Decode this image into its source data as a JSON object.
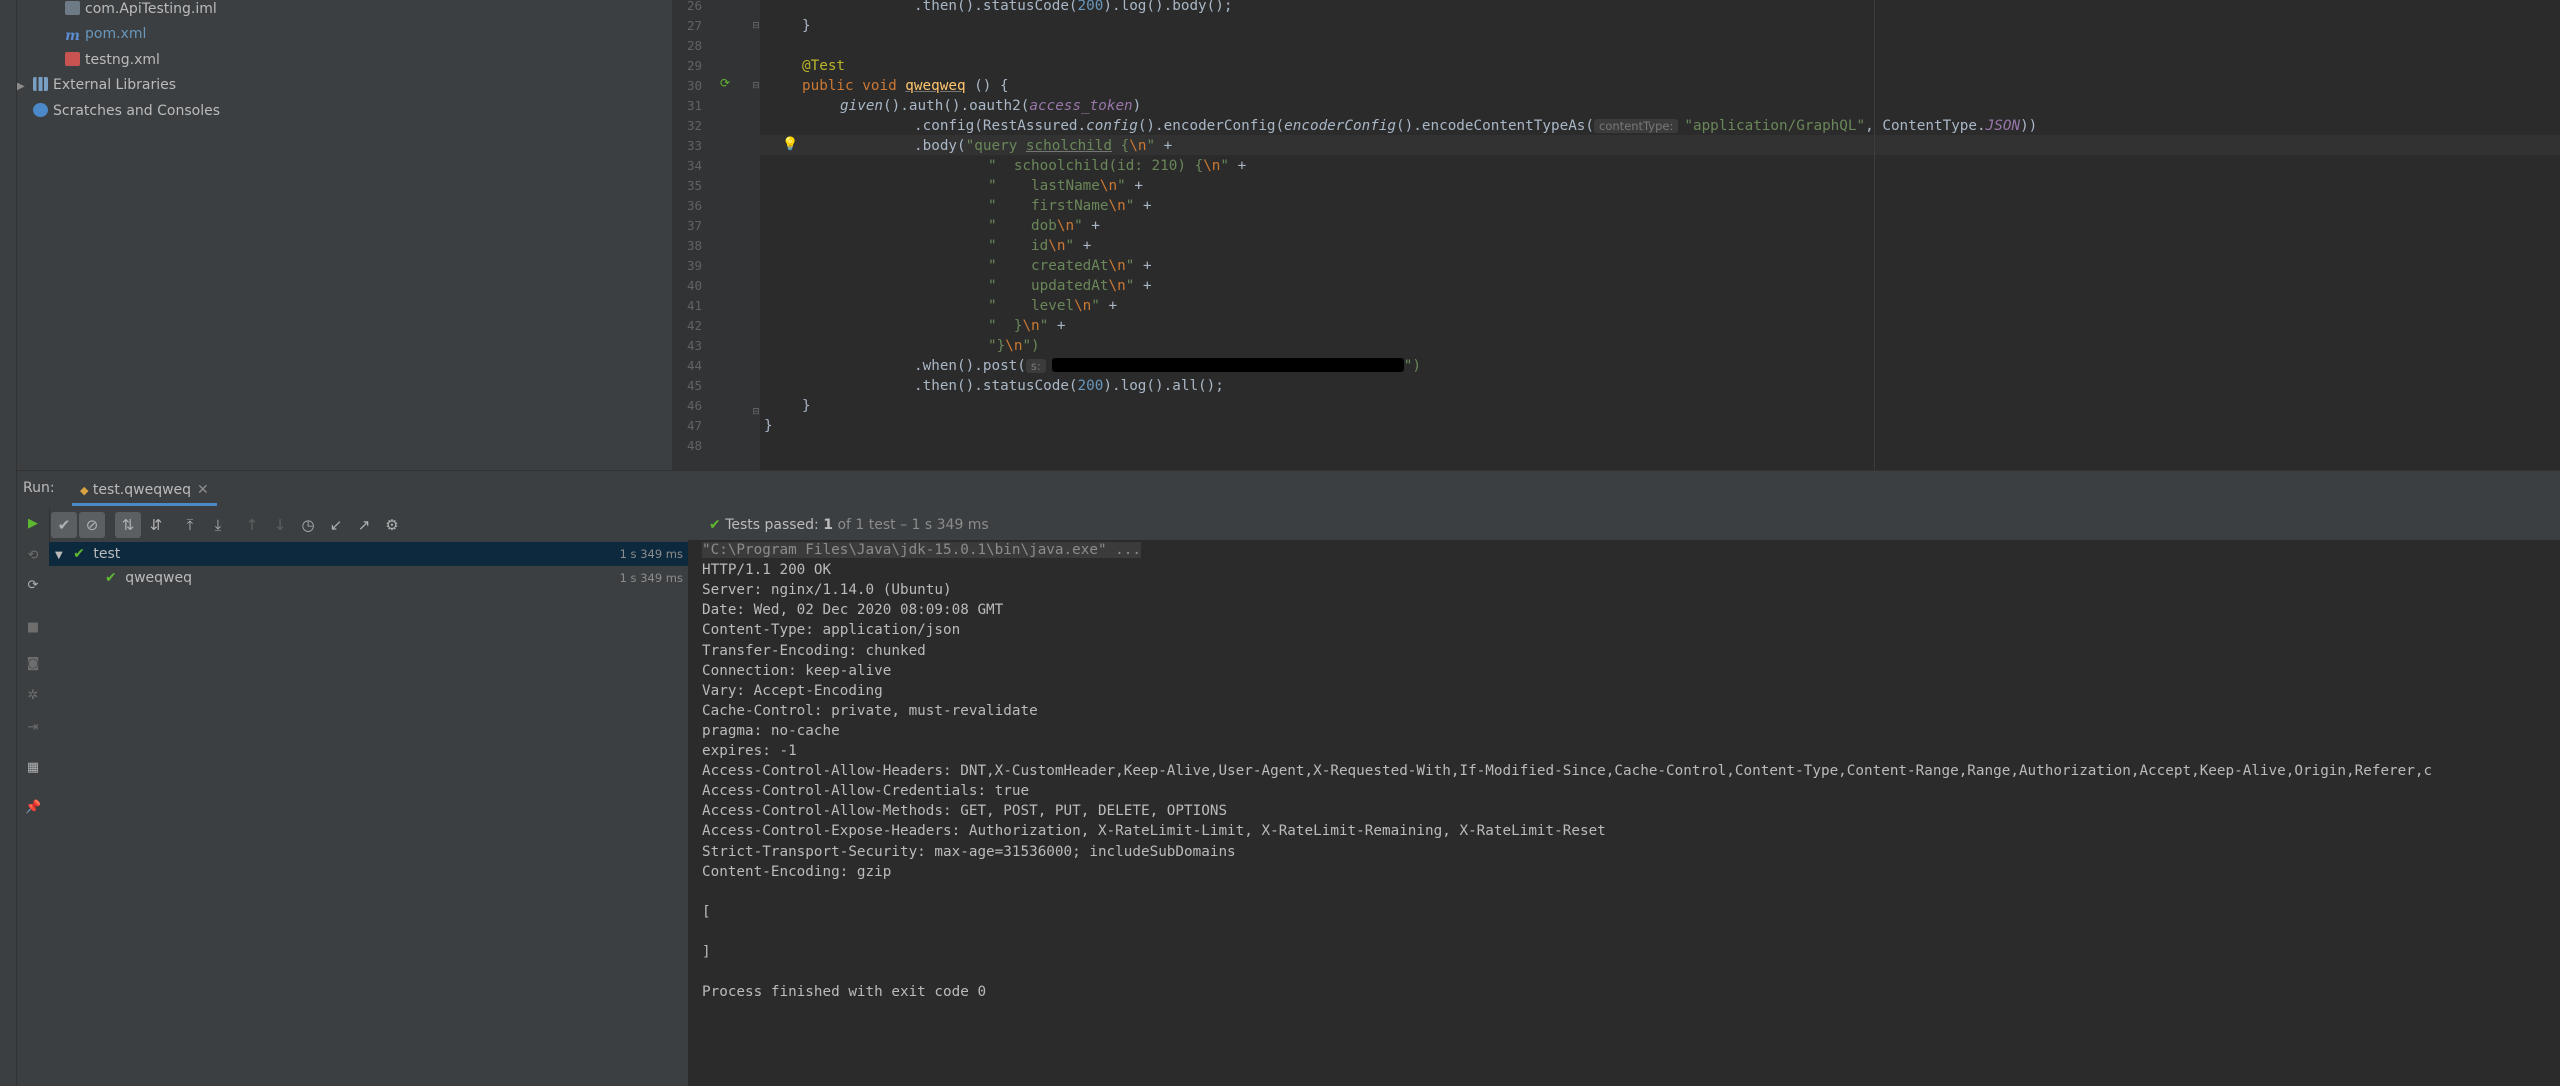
{
  "project_tree": [
    {
      "label": "com.ApiTesting.iml",
      "icon": "iml-file-icon",
      "color": "#bbbbbb"
    },
    {
      "label": "pom.xml",
      "icon": "maven-file-icon",
      "color": "#6897bb"
    },
    {
      "label": "testng.xml",
      "icon": "xml-file-icon",
      "color": "#bbbbbb"
    },
    {
      "label": "External Libraries",
      "icon": "libraries-icon",
      "color": "#bbbbbb"
    },
    {
      "label": "Scratches and Consoles",
      "icon": "scratches-icon",
      "color": "#bbbbbb"
    }
  ],
  "editor": {
    "line_numbers": [
      "26",
      "27",
      "28",
      "29",
      "30",
      "31",
      "32",
      "33",
      "34",
      "35",
      "36",
      "37",
      "38",
      "39",
      "40",
      "41",
      "42",
      "43",
      "44",
      "45",
      "46",
      "47",
      "48"
    ],
    "l26": ".then().statusCode(",
    "l26_num": "200",
    "l26_end": ").log().body();",
    "l27": "}",
    "l29": "@Test",
    "l30_kw": "public void",
    "l30_fn": "qweqweq",
    "l30_end": " () {",
    "l31_fn": "given",
    "l31_mid": "().auth().oauth2(",
    "l31_fld": "access_token",
    "l31_end": ")",
    "l32_a": ".config(RestAssured.",
    "l32_b": "config",
    "l32_c": "().encoderConfig(",
    "l32_d": "encoderConfig",
    "l32_e": "().encodeContentTypeAs(",
    "l32_hint": "contentType:",
    "l32_str": "\"application/GraphQL\"",
    "l32_f": ", ContentType.",
    "l32_g": "JSON",
    "l32_h": "))",
    "l33_a": ".body(",
    "l33_s1": "\"query ",
    "l33_s2": "scholchild",
    "l33_s3": " {",
    "l33_esc": "\\n",
    "l33_s4": "\"",
    "l33_plus": " +",
    "body_lines": [
      {
        "s": "\"  schoolchild(id: 210) {",
        "e": "\\n",
        "t": "\" +"
      },
      {
        "s": "\"    lastName",
        "e": "\\n",
        "t": "\" +"
      },
      {
        "s": "\"    firstName",
        "e": "\\n",
        "t": "\" +"
      },
      {
        "s": "\"    dob",
        "e": "\\n",
        "t": "\" +"
      },
      {
        "s": "\"    id",
        "e": "\\n",
        "t": "\" +"
      },
      {
        "s": "\"    createdAt",
        "e": "\\n",
        "t": "\" +"
      },
      {
        "s": "\"    updatedAt",
        "e": "\\n",
        "t": "\" +"
      },
      {
        "s": "\"    level",
        "e": "\\n",
        "t": "\" +"
      },
      {
        "s": "\"  }",
        "e": "\\n",
        "t": "\" +"
      }
    ],
    "l43_s": "\"}",
    "l43_e": "\\n",
    "l43_t": "\")",
    "l44_a": ".when().post(",
    "l44_hint": "s:",
    "l44_end": "\")",
    "l45_a": ".then().statusCode(",
    "l45_num": "200",
    "l45_b": ").log().all();",
    "l46": "}",
    "l47": "}"
  },
  "run": {
    "title": "Run:",
    "tab_label": "test.qweqweq",
    "tab_close": "✕",
    "status_prefix": "Tests passed:",
    "status_count": "1",
    "status_rest": "of 1 test – 1 s 349 ms",
    "tree": [
      {
        "label": "test",
        "duration": "1 s 349 ms"
      },
      {
        "label": "qweqweq",
        "duration": "1 s 349 ms"
      }
    ]
  },
  "console": [
    "\"C:\\Program Files\\Java\\jdk-15.0.1\\bin\\java.exe\" ...",
    "HTTP/1.1 200 OK",
    "Server: nginx/1.14.0 (Ubuntu)",
    "Date: Wed, 02 Dec 2020 08:09:08 GMT",
    "Content-Type: application/json",
    "Transfer-Encoding: chunked",
    "Connection: keep-alive",
    "Vary: Accept-Encoding",
    "Cache-Control: private, must-revalidate",
    "pragma: no-cache",
    "expires: -1",
    "Access-Control-Allow-Headers: DNT,X-CustomHeader,Keep-Alive,User-Agent,X-Requested-With,If-Modified-Since,Cache-Control,Content-Type,Content-Range,Range,Authorization,Accept,Keep-Alive,Origin,Referer,c",
    "Access-Control-Allow-Credentials: true",
    "Access-Control-Allow-Methods: GET, POST, PUT, DELETE, OPTIONS",
    "Access-Control-Expose-Headers: Authorization, X-RateLimit-Limit, X-RateLimit-Remaining, X-RateLimit-Reset",
    "Strict-Transport-Security: max-age=31536000; includeSubDomains",
    "Content-Encoding: gzip",
    "",
    "[",
    "",
    "]",
    "",
    "Process finished with exit code 0"
  ],
  "colors": {
    "accent": "#4a88c7",
    "pass_green": "#5fb832",
    "selection": "#0d293e"
  }
}
